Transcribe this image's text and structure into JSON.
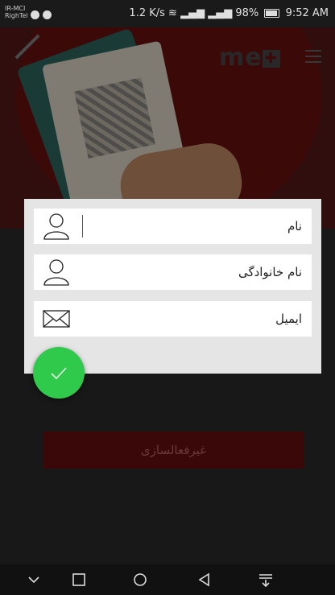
{
  "status_bar": {
    "carrier_line1": "IR-MCI",
    "carrier_line2": "RighTel",
    "net_speed": "1.2 K/s",
    "battery": "98%",
    "time": "9:52 AM"
  },
  "header": {
    "logo_text": "me"
  },
  "form": {
    "fields": [
      {
        "label": "نام",
        "icon": "person-icon"
      },
      {
        "label": "نام خانوادگی",
        "icon": "person-icon"
      },
      {
        "label": "ایمیل",
        "icon": "envelope-icon"
      }
    ],
    "submit_icon": "check-icon"
  },
  "main": {
    "deactivate_label": "غیرفعالسازی"
  },
  "nav": {
    "icons": [
      "collapse-icon",
      "recents-icon",
      "home-icon",
      "back-icon",
      "notifications-icon"
    ]
  },
  "colors": {
    "accent": "#2fc94b",
    "brand_red": "#6d1111",
    "dialog_bg": "#e5e5e5"
  }
}
